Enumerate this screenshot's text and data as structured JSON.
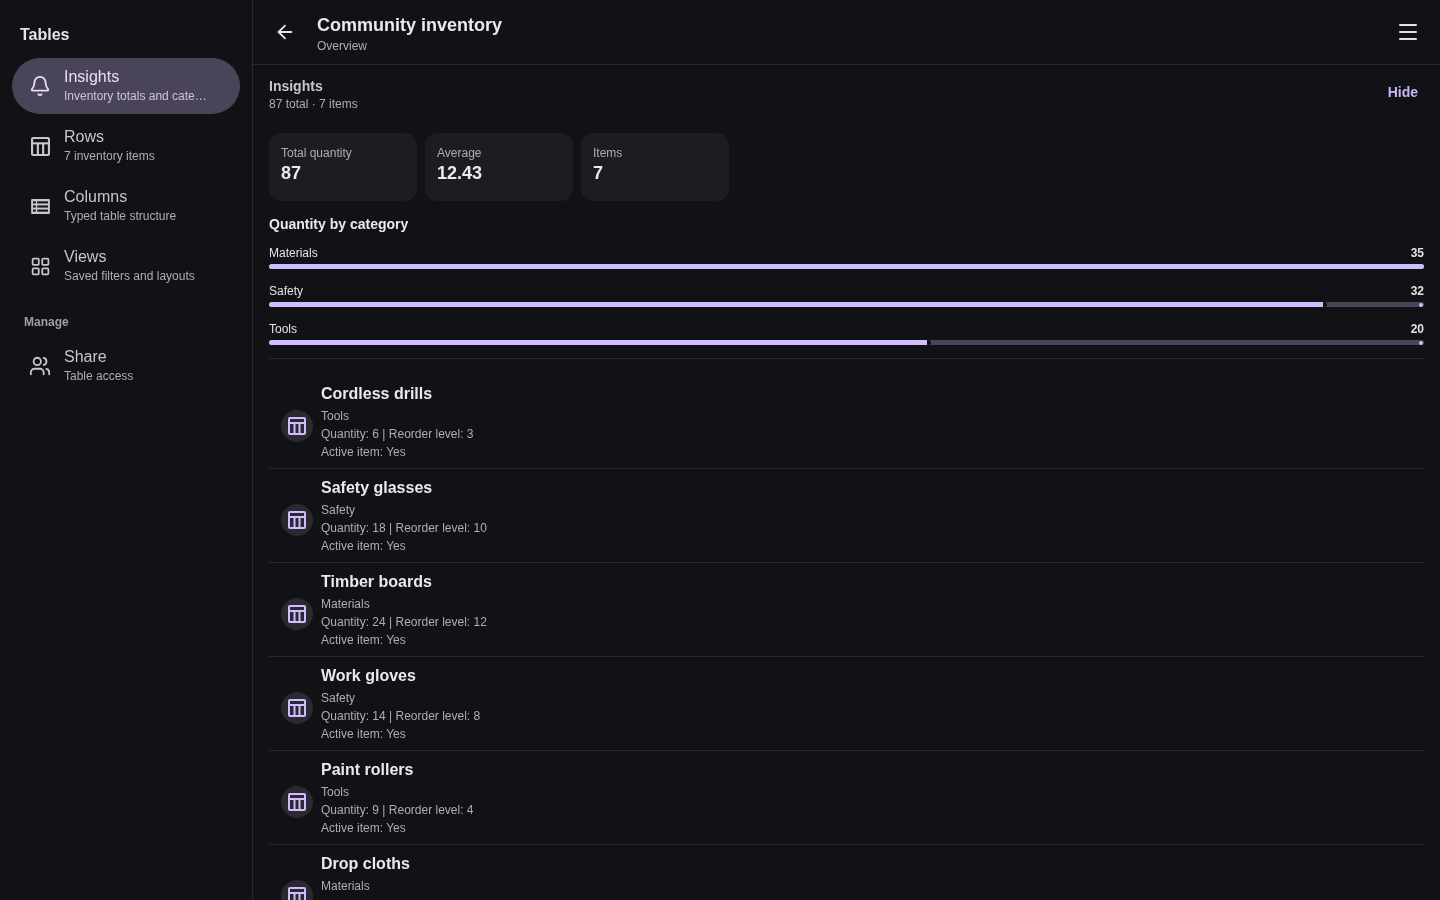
{
  "sidebar": {
    "title": "Tables",
    "sections": [
      {
        "items": [
          {
            "label": "Insights",
            "subtitle": "Inventory totals and cate…",
            "selected": true
          },
          {
            "label": "Rows",
            "subtitle": "7 inventory items",
            "selected": false
          },
          {
            "label": "Columns",
            "subtitle": "Typed table structure",
            "selected": false
          },
          {
            "label": "Views",
            "subtitle": "Saved filters and layouts",
            "selected": false
          }
        ]
      },
      {
        "heading": "Manage",
        "items": [
          {
            "label": "Share",
            "subtitle": "Table access",
            "selected": false
          }
        ]
      }
    ]
  },
  "header": {
    "title": "Community inventory",
    "subtitle": "Overview"
  },
  "insights": {
    "title": "Insights",
    "summary": "87 total · 7 items",
    "hide_label": "Hide",
    "stats": [
      {
        "label": "Total quantity",
        "value": "87"
      },
      {
        "label": "Average",
        "value": "12.43"
      },
      {
        "label": "Items",
        "value": "7"
      }
    ],
    "chart_title": "Quantity by category",
    "categories": [
      {
        "label": "Materials",
        "reading": "35",
        "level": 1
      },
      {
        "label": "Safety",
        "reading": "32",
        "level": 0.914
      },
      {
        "label": "Tools",
        "reading": "20",
        "level": 0.571
      }
    ]
  },
  "items": [
    {
      "name": "Cordless drills",
      "category": "Tools",
      "details": "Quantity: 6 | Reorder level: 3",
      "active": "Active item: Yes"
    },
    {
      "name": "Safety glasses",
      "category": "Safety",
      "details": "Quantity: 18 | Reorder level: 10",
      "active": "Active item: Yes"
    },
    {
      "name": "Timber boards",
      "category": "Materials",
      "details": "Quantity: 24 | Reorder level: 12",
      "active": "Active item: Yes"
    },
    {
      "name": "Work gloves",
      "category": "Safety",
      "details": "Quantity: 14 | Reorder level: 8",
      "active": "Active item: Yes"
    },
    {
      "name": "Paint rollers",
      "category": "Tools",
      "details": "Quantity: 9 | Reorder level: 4",
      "active": "Active item: Yes"
    },
    {
      "name": "Drop cloths",
      "category": "Materials"
    }
  ]
}
